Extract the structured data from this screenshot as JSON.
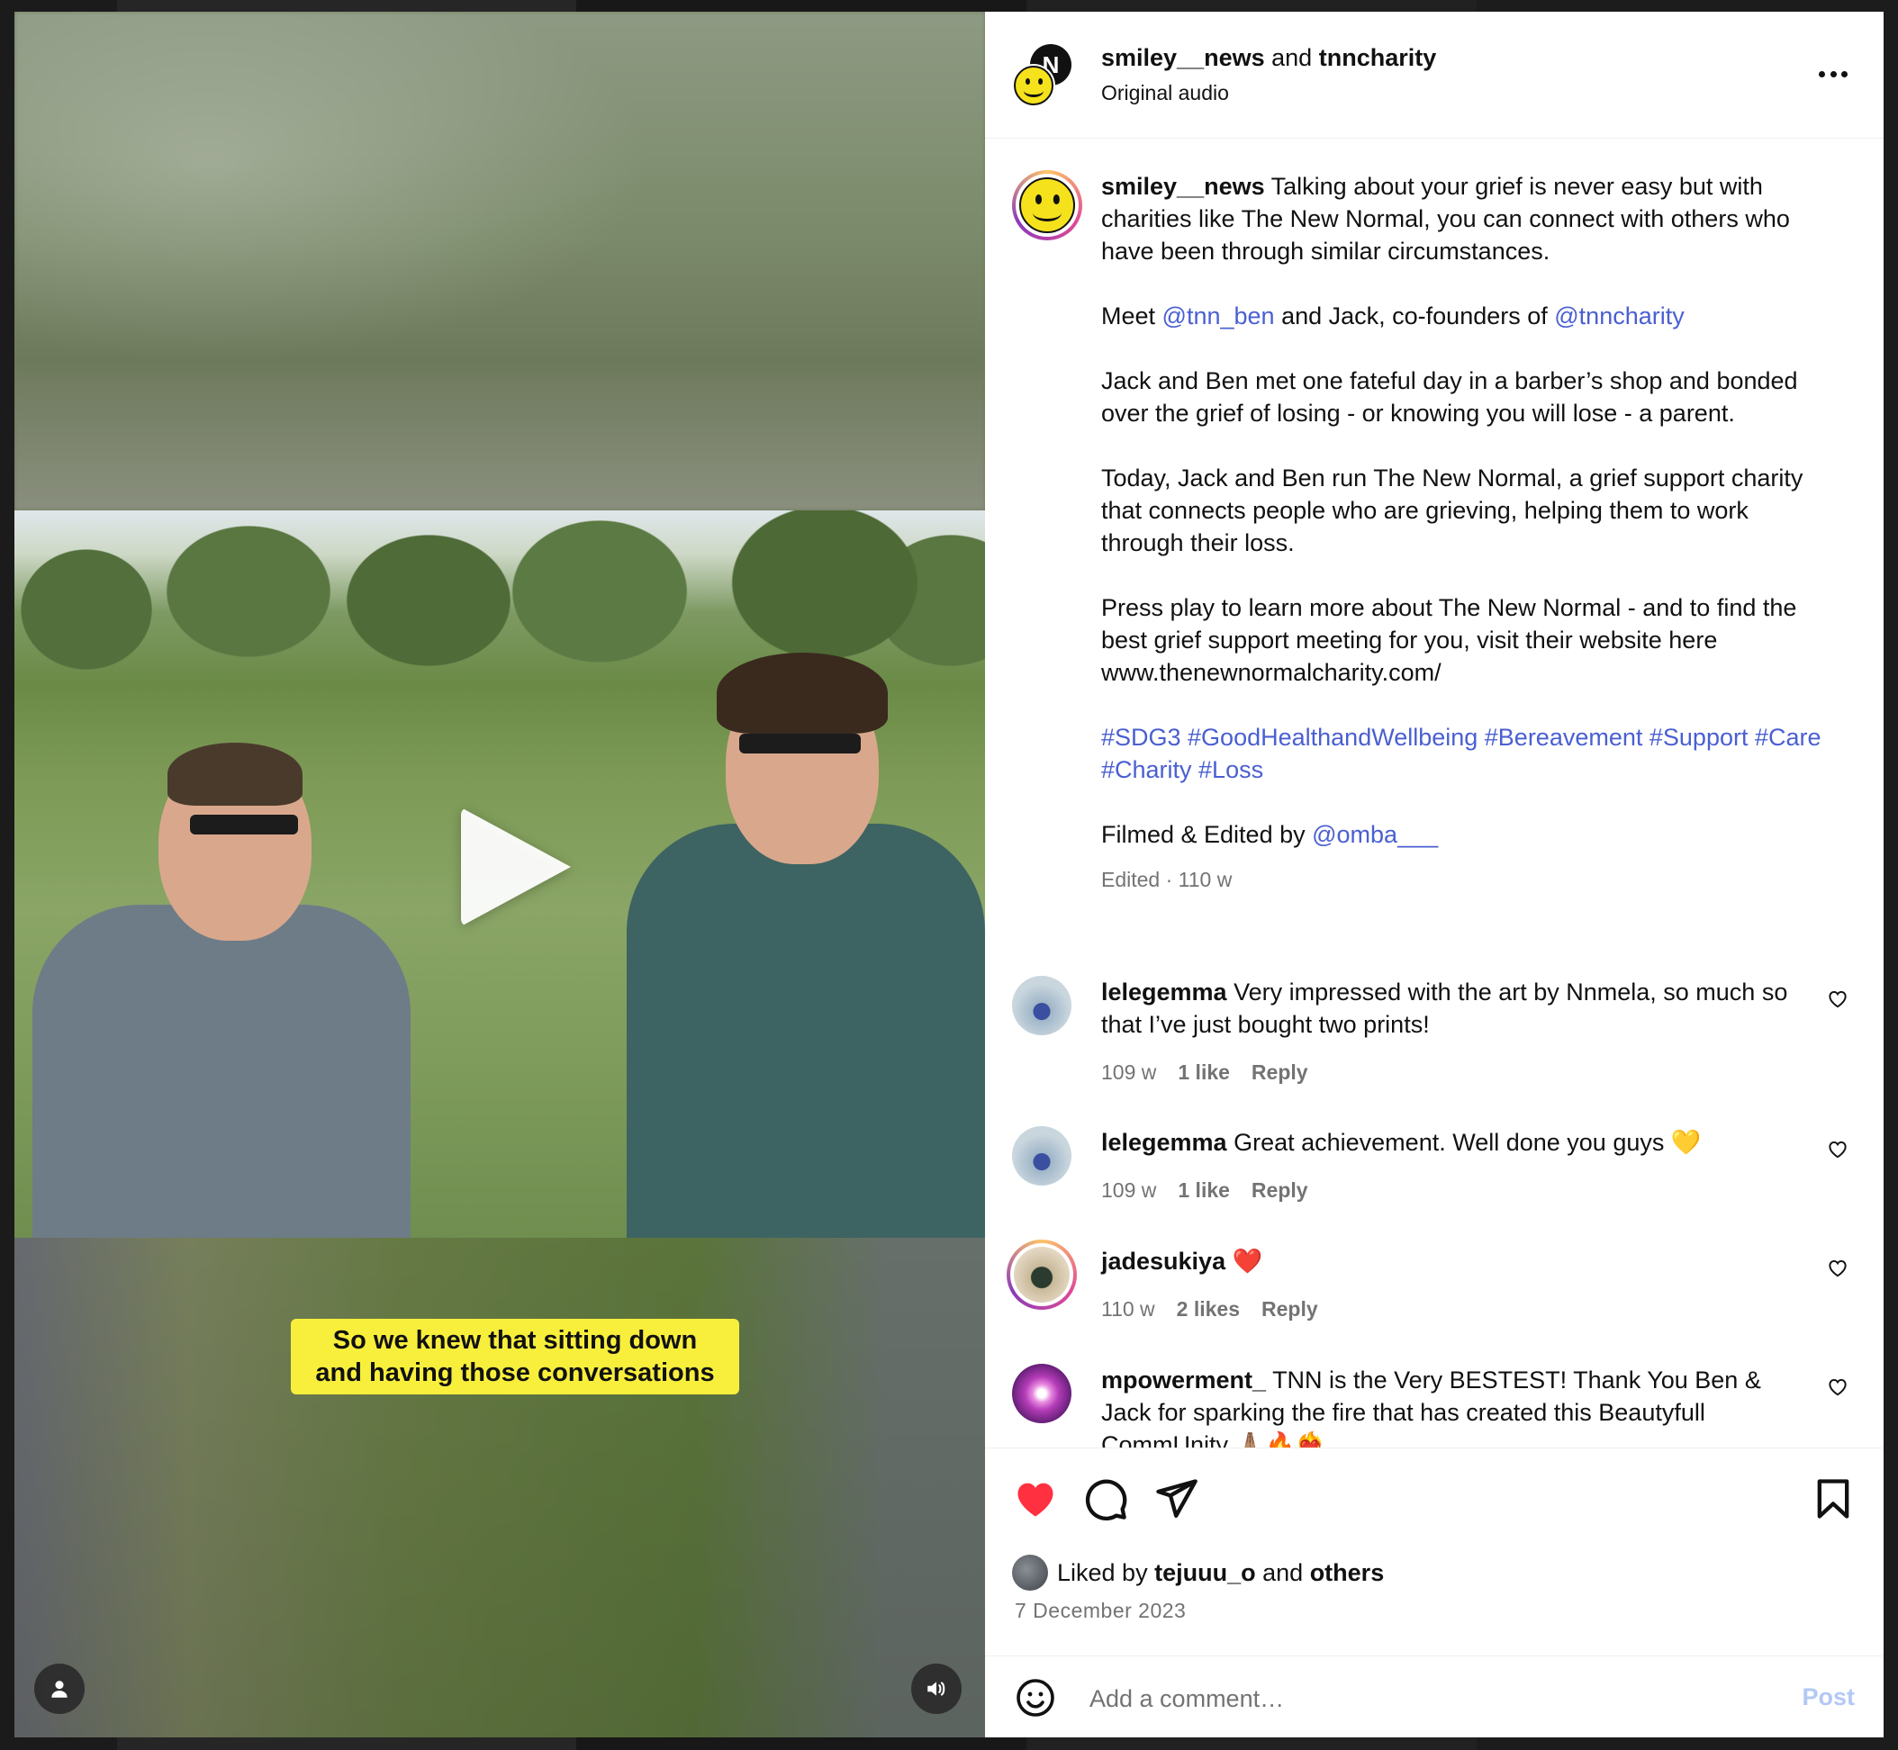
{
  "header": {
    "user1": "smiley__news",
    "joiner": "and",
    "user2": "tnncharity",
    "subtitle": "Original audio",
    "avatar_letter": "N"
  },
  "caption": {
    "username": "smiley__news",
    "p1": "Talking about your grief is never easy but with charities like The New Normal, you can connect with others who have been through similar circumstances.",
    "p2_prefix": "Meet",
    "p2_mention1": "@tnn_ben",
    "p2_mid": "and Jack, co-founders of",
    "p2_mention2": "@tnncharity",
    "p3": "Jack and Ben met one fateful day in a barber’s shop and bonded over the grief of losing - or knowing you will lose - a parent.",
    "p4": "Today, Jack and Ben run The New Normal, a grief support charity that connects people who are grieving, helping them to work through their loss.",
    "p5": "Press play to learn more about The New Normal - and to find the best grief support meeting for you, visit their website here www.thenewnormalcharity.com/",
    "hashtags": "#SDG3 #GoodHealthandWellbeing #Bereavement #Support #Care #Charity #Loss",
    "p7_prefix": "Filmed & Edited by",
    "p7_mention": "@omba___",
    "meta": "Edited · 110 w"
  },
  "comments": [
    {
      "username": "lelegemma",
      "text": "Very impressed with the art by Nnmela, so much so that I’ve just bought two prints!",
      "age": "109 w",
      "likes": "1 like",
      "reply": "Reply"
    },
    {
      "username": "lelegemma",
      "text": "Great achievement. Well done you guys 💛",
      "age": "109 w",
      "likes": "1 like",
      "reply": "Reply"
    },
    {
      "username": "jadesukiya",
      "text": "❤️",
      "age": "110 w",
      "likes": "2 likes",
      "reply": "Reply"
    },
    {
      "username": "mpowerment_",
      "text": "TNN is the Very BESTEST! Thank You Ben & Jack for sparking the fire that has created this Beautyfull CommUnity 🙏🏽🔥❤️‍🔥",
      "age": "",
      "likes": "",
      "reply": ""
    }
  ],
  "video": {
    "caption_line1": "So we knew that sitting down",
    "caption_line2": "and having those conversations"
  },
  "actions": {
    "liked_prefix": "Liked by",
    "liked_user": "tejuuu_o",
    "liked_and": "and",
    "liked_others": "others",
    "date": "7 December 2023"
  },
  "add_comment": {
    "placeholder": "Add a comment…",
    "post_label": "Post"
  },
  "colors": {
    "link": "#4a5fd1",
    "like_red": "#ff3040",
    "post_disabled": "#b3c8f5",
    "caption_yellow": "#f8ef3c"
  }
}
